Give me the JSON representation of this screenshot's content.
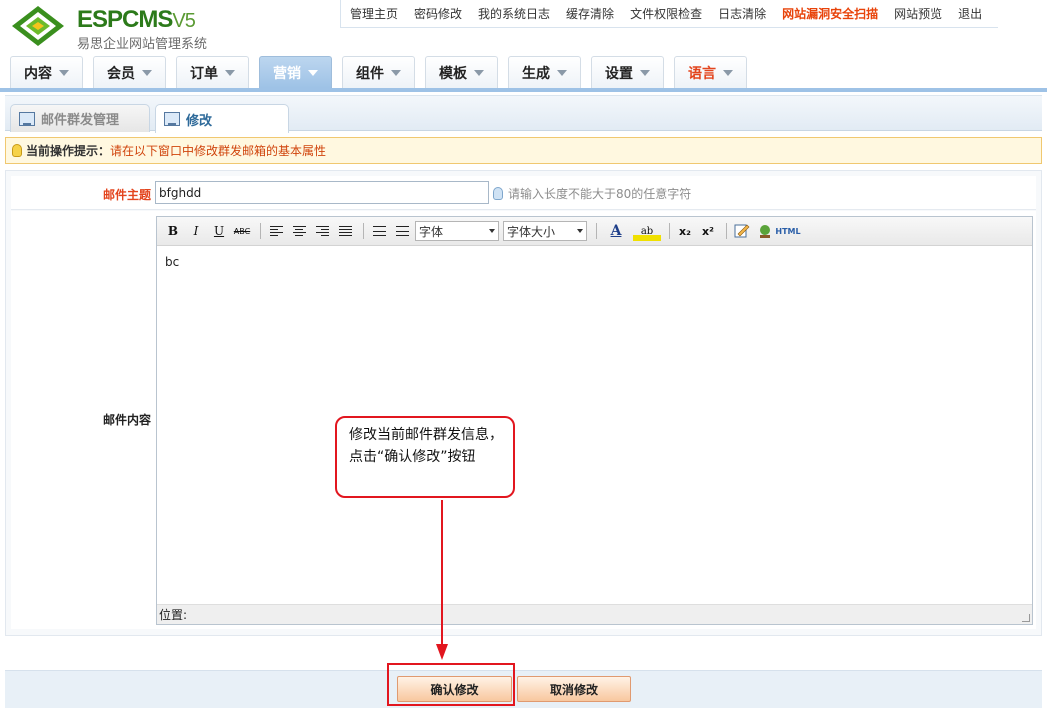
{
  "brand": {
    "logo_main": "ESPCMS",
    "logo_version": "V5",
    "logo_sub": "易思企业网站管理系统",
    "colors": {
      "green": "#2c7a1a",
      "accent": "#e3451e",
      "nav_blue": "#9ec2e6"
    }
  },
  "topnav": [
    {
      "label": "管理主页"
    },
    {
      "label": "密码修改"
    },
    {
      "label": "我的系统日志"
    },
    {
      "label": "缓存清除"
    },
    {
      "label": "文件权限检查"
    },
    {
      "label": "日志清除"
    },
    {
      "label": "网站漏洞安全扫描",
      "highlight": true
    },
    {
      "label": "网站预览"
    },
    {
      "label": "退出"
    }
  ],
  "mainnav": [
    {
      "label": "内容"
    },
    {
      "label": "会员"
    },
    {
      "label": "订单"
    },
    {
      "label": "营销",
      "active": true
    },
    {
      "label": "组件"
    },
    {
      "label": "模板"
    },
    {
      "label": "生成"
    },
    {
      "label": "设置"
    },
    {
      "label": "语言",
      "red": true
    }
  ],
  "subtabs": {
    "tab1": "邮件群发管理",
    "tab2": "修改"
  },
  "tip": {
    "prefix": "当前操作提示：",
    "text": "请在以下窗口中修改群发邮箱的基本属性"
  },
  "form": {
    "subject_label": "邮件主题",
    "subject_value": "bfghdd",
    "subject_hint": "请输入长度不能大于80的任意字符",
    "content_label": "邮件内容",
    "content_value": "bc",
    "status_label": "位置:"
  },
  "editor_toolbar": {
    "bold": "B",
    "italic": "I",
    "underline": "U",
    "strike": "ABC",
    "font_select": "字体",
    "size_select": "字体大小",
    "font_color": "A",
    "highlight": "ab",
    "subscript": "x₂",
    "superscript": "x²",
    "html": "HTML"
  },
  "callout": {
    "text": "修改当前邮件群发信息，点击“确认修改”按钮"
  },
  "buttons": {
    "confirm": "确认修改",
    "cancel": "取消修改"
  }
}
